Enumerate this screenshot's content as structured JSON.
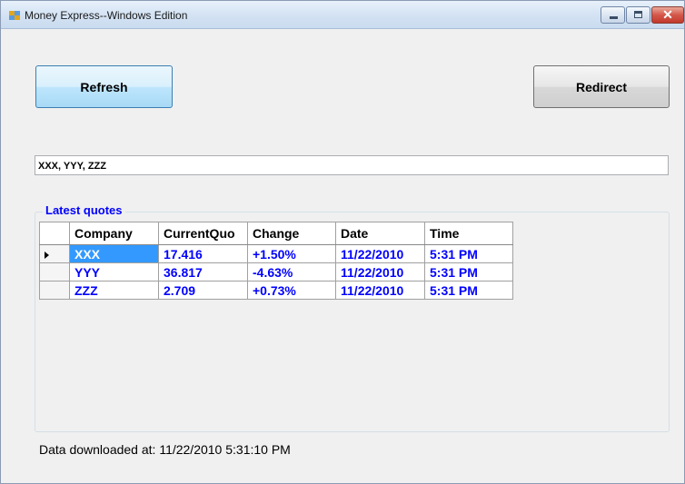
{
  "window": {
    "title": "Money Express--Windows Edition",
    "close_glyph": "✕"
  },
  "toolbar": {
    "refresh_label": "Refresh",
    "redirect_label": "Redirect"
  },
  "symbols_field": {
    "value": "XXX, YYY, ZZZ"
  },
  "quotes_group": {
    "label": "Latest quotes",
    "columns": [
      "Company",
      "CurrentQuo",
      "Change",
      "Date",
      "Time"
    ],
    "rows": [
      {
        "company": "XXX",
        "current": "17.416",
        "change": "+1.50%",
        "date": "11/22/2010",
        "time": "5:31 PM"
      },
      {
        "company": "YYY",
        "current": "36.817",
        "change": "-4.63%",
        "date": "11/22/2010",
        "time": "5:31 PM"
      },
      {
        "company": "ZZZ",
        "current": "2.709",
        "change": "+0.73%",
        "date": "11/22/2010",
        "time": "5:31 PM"
      }
    ]
  },
  "status": {
    "text": "Data downloaded at: 11/22/2010 5:31:10 PM"
  },
  "colors": {
    "accent_text": "#0000ff",
    "selection": "#3399ff"
  }
}
